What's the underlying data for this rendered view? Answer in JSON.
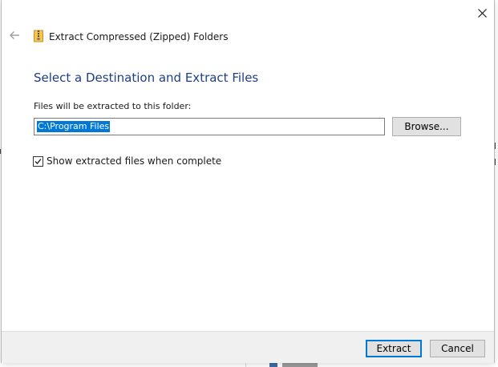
{
  "dialog": {
    "title": "Extract Compressed (Zipped) Folders",
    "section_title": "Select a Destination and Extract Files",
    "field_label": "Files will be extracted to this folder:",
    "path_value": "C:\\Program Files",
    "browse_label": "Browse...",
    "checkbox_label": "Show extracted files when complete",
    "checkbox_checked": true,
    "extract_label": "Extract",
    "cancel_label": "Cancel"
  },
  "icons": {
    "close": "close-icon",
    "back": "back-arrow-icon",
    "zip_folder": "zip-folder-icon",
    "check": "checkmark-icon"
  },
  "colors": {
    "section_title": "#1d3e8a",
    "selection": "#0078d7",
    "footer_bg": "#f0f0f0",
    "button_bg": "#e1e1e1",
    "default_button_border": "#0078d7"
  }
}
